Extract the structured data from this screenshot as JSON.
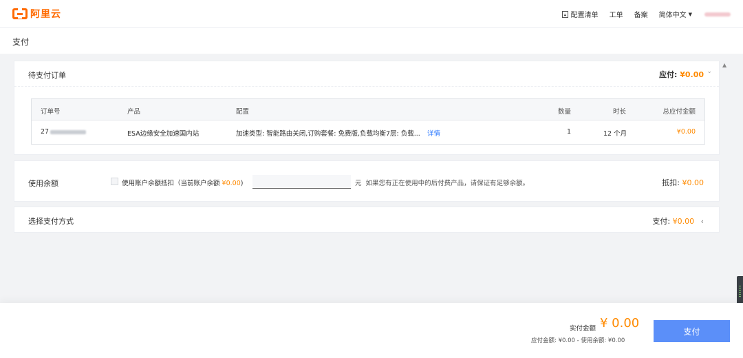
{
  "header": {
    "logo_text": "阿里云",
    "nav": {
      "config_list": "配置清单",
      "ticket": "工单",
      "filing": "备案",
      "language": "简体中文"
    }
  },
  "page": {
    "title": "支付"
  },
  "pending_orders": {
    "title": "待支付订单",
    "payable_label": "应付:",
    "payable_value": "¥0.00",
    "columns": {
      "order_no": "订单号",
      "product": "产品",
      "config": "配置",
      "quantity": "数量",
      "duration": "时长",
      "total": "总应付金额"
    },
    "row": {
      "order_no_prefix": "27",
      "product": "ESA边缘安全加速国内站",
      "config": "加速类型: 智能路由关闭,订购套餐: 免费版,负载均衡7层: 负载...",
      "detail_link": "详情",
      "quantity": "1",
      "duration": "12 个月",
      "total": "¥0.00"
    }
  },
  "balance": {
    "title": "使用余额",
    "checkbox_label_prefix": "使用账户余额抵扣（当前账户余额",
    "current_balance": "¥0.00",
    "checkbox_label_suffix": ")",
    "unit": "元",
    "hint": "如果您有正在使用中的后付费产品，请保证有足够余额。",
    "deduct_label": "抵扣:",
    "deduct_value": "¥0.00"
  },
  "payment_method": {
    "title": "选择支付方式",
    "pay_label": "支付:",
    "pay_value": "¥0.00"
  },
  "footer": {
    "actual_label": "实付金额",
    "actual_value": "¥ 0.00",
    "breakdown": "应付金额: ¥0.00 - 使用余额: ¥0.00",
    "pay_button": "支付"
  },
  "colors": {
    "accent": "#ff8a00",
    "brand": "#ff6a00",
    "button": "#5b8ff9",
    "link": "#2f7bff"
  },
  "icons": [
    "aliyun-logo-icon",
    "list-icon",
    "caret-down-icon",
    "chevron-down-icon",
    "chevron-left-icon",
    "scroll-up-icon"
  ]
}
